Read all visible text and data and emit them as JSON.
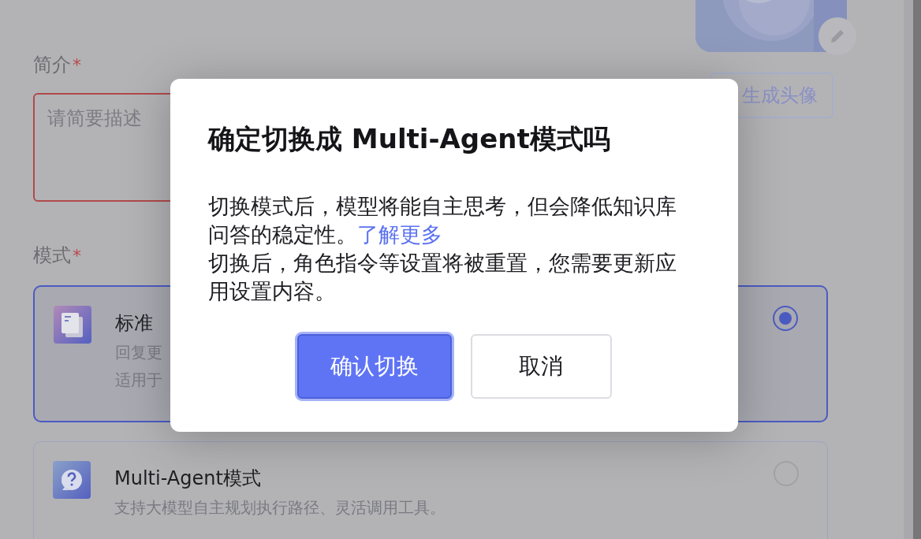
{
  "form": {
    "description": {
      "label": "简介",
      "required_mark": "*",
      "placeholder": "请简要描述"
    },
    "avatar": {
      "generate_button": "生成头像"
    },
    "mode": {
      "label": "模式",
      "required_mark": "*",
      "options": [
        {
          "kind": "document",
          "title": "标准",
          "lines": [
            "回复更",
            "适用于"
          ],
          "selected": true
        },
        {
          "kind": "question",
          "title": "Multi-Agent模式",
          "lines": [
            "支持大模型自主规划执行路径、灵活调用工具。"
          ],
          "selected": false
        }
      ]
    }
  },
  "dialog": {
    "title": "确定切换成 Multi-Agent模式吗",
    "paragraphs": [
      {
        "text": "切换模式后，模型将能自主思考，但会降低知识库问答的稳定性。",
        "link": "了解更多"
      },
      {
        "text": "切换后，角色指令等设置将被重置，您需要更新应用设置内容。"
      }
    ],
    "buttons": [
      {
        "kind": "primary",
        "label": "确认切换"
      },
      {
        "kind": "secondary",
        "label": "取消"
      }
    ]
  }
}
